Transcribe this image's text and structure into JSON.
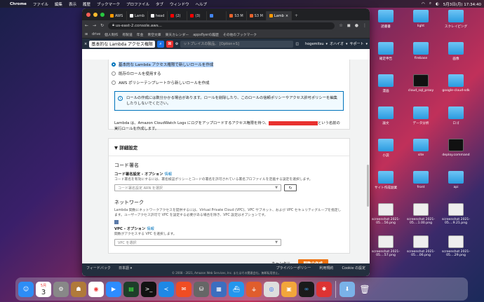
{
  "menubar": {
    "app": "Chrome",
    "items": [
      "ファイル",
      "編集",
      "表示",
      "履歴",
      "ブックマーク",
      "プロファイル",
      "タブ",
      "ウィンドウ",
      "ヘルプ"
    ],
    "clock": "5月3日(月) 17:34:40"
  },
  "tabs": [
    {
      "label": "AWS"
    },
    {
      "label": "Lamb"
    },
    {
      "label": "head"
    },
    {
      "label": "(2)"
    },
    {
      "label": "(3)"
    },
    {
      "label": ""
    },
    {
      "label": "S3 M"
    },
    {
      "label": "S3 M"
    },
    {
      "label": "Lamb"
    }
  ],
  "address": "us-east-2.console.aws...",
  "bookmarks": [
    "drive",
    "個人制作",
    "有製道",
    "年金",
    "青空文庫",
    "東天カレンダー",
    "appsflyerの履歴",
    "その他のブックマーク"
  ],
  "findbar": {
    "query": "基本的な Lambda アクセス権限",
    "placeholder": "ットプレイスの製品、 [Option+S]",
    "user": "hogemitsu",
    "region": "オハイオ",
    "support": "サポート"
  },
  "roles": {
    "options": [
      "基本的な Lambda アクセス権限で新しいロールを作成",
      "既存のロールを使用する",
      "AWS ポリシーテンプレートから新しいロールを作成"
    ],
    "info": "ロールの作成には数分かかる場合があります。ロールを削除したり、このロールの信頼ポリシーやアクセス許可ポリシーを編集したりしないでください。",
    "note_pre": "Lambda は、Amazon CloudWatch Logs にログをアップロードするアクセス権限を持つ、",
    "note_post": "という名前の実行ロールを作成します。"
  },
  "advanced": {
    "title": "詳細設定",
    "code_sign_title": "コード署名",
    "code_sign_label": "コード署名設定 - オプション",
    "info_link": "情報",
    "code_sign_desc": "コード署名を有効にするには、署名検証ポリシーとコードの署名を許可されている署名プロファイルを定義する設定を選択します。",
    "code_sign_placeholder": "コード署名設定 ARN を選択",
    "network_title": "ネットワーク",
    "network_desc": "Lambda 関数にネットワークアクセスを提供するには、Virtual Private Cloud (VPC)、VPC サブネット、および VPC セキュリティグループを指定します。ユーザーアクセス許可で VPC を設定する必要がある場合を除き、VPC 設定はオプションです。",
    "vpc_label": "VPC - オプション",
    "vpc_info": "情報",
    "vpc_desc": "関数がアクセスする VPC を選択します。",
    "vpc_placeholder": "VPC を選択"
  },
  "actions": {
    "cancel": "キャンセル",
    "create": "関数の作成"
  },
  "footer": {
    "feedback": "フィードバック",
    "lang": "日本語",
    "copyright": "© 2008 - 2021, Amazon Web Services, Inc. またはその関連会社。無断転用禁止。",
    "privacy": "プライバシーポリシー",
    "terms": "利用規約",
    "cookie": "Cookie の設定"
  },
  "desktop": [
    {
      "label": "読書書",
      "kind": "folder"
    },
    {
      "label": "light",
      "kind": "folder"
    },
    {
      "label": "スクレイピング",
      "kind": "folder"
    },
    {
      "label": "確定申告",
      "kind": "folder"
    },
    {
      "label": "firebase",
      "kind": "folder"
    },
    {
      "label": "画像",
      "kind": "folder"
    },
    {
      "label": "漫画",
      "kind": "folder"
    },
    {
      "label": "cloud_sql_proxy",
      "kind": "term"
    },
    {
      "label": "google-cloud-sdk",
      "kind": "folder"
    },
    {
      "label": "論文",
      "kind": "folder"
    },
    {
      "label": "データ分析",
      "kind": "folder"
    },
    {
      "label": "ロゴ",
      "kind": "folder"
    },
    {
      "label": "小説",
      "kind": "folder"
    },
    {
      "label": "site",
      "kind": "folder"
    },
    {
      "label": "deploy.command",
      "kind": "term"
    },
    {
      "label": "サイト作成副業",
      "kind": "folder"
    },
    {
      "label": "front",
      "kind": "folder"
    },
    {
      "label": "api",
      "kind": "folder"
    },
    {
      "label": "screenshot 2021-05....56.png",
      "kind": "shot"
    },
    {
      "label": "screenshot 2021-05....1.00.png",
      "kind": "shot"
    },
    {
      "label": "screenshot 2021-05....9.21.png",
      "kind": "shot"
    },
    {
      "label": "screenshot 2021-05....57.png",
      "kind": "shot"
    },
    {
      "label": "screenshot 2021-05....06.png",
      "kind": "shot"
    },
    {
      "label": "screenshot 2021-05....29.png",
      "kind": "shot"
    }
  ],
  "calendar": {
    "month": "5月",
    "day": "3"
  }
}
